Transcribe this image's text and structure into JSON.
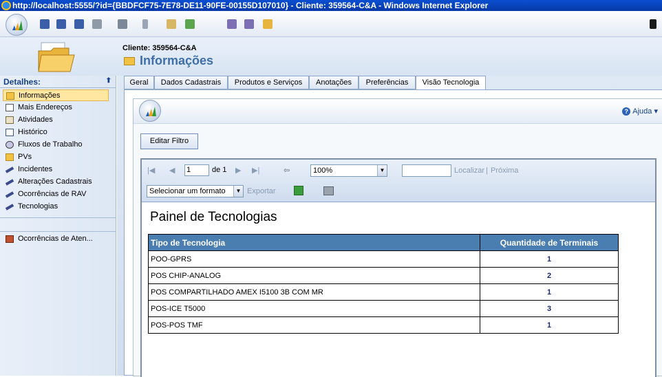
{
  "window": {
    "title": "http://localhost:5555/?id={BBDFCF75-7E78-DE11-90FE-00155D107010} - Cliente: 359564-C&A - Windows Internet Explorer"
  },
  "header": {
    "client": "Cliente: 359564-C&A",
    "title": "Informações"
  },
  "sidebar": {
    "title": "Detalhes:",
    "items": [
      {
        "label": "Informações",
        "icon": "folder-icon"
      },
      {
        "label": "Mais Endereços",
        "icon": "address-icon"
      },
      {
        "label": "Atividades",
        "icon": "activities-icon"
      },
      {
        "label": "Histórico",
        "icon": "history-icon"
      },
      {
        "label": "Fluxos de Trabalho",
        "icon": "workflow-icon"
      },
      {
        "label": "PVs",
        "icon": "folder-icon"
      },
      {
        "label": "Incidentes",
        "icon": "pen-icon"
      },
      {
        "label": "Alterações Cadastrais",
        "icon": "pen-icon"
      },
      {
        "label": "Ocorrências de RAV",
        "icon": "pen-icon"
      },
      {
        "label": "Tecnologias",
        "icon": "pen-icon"
      }
    ],
    "extra_item": {
      "label": "Ocorrências de Aten...",
      "icon": "briefcase-icon"
    }
  },
  "tabs": [
    "Geral",
    "Dados Cadastrais",
    "Produtos e Serviços",
    "Anotações",
    "Preferências",
    "Visão Tecnologia"
  ],
  "active_tab": "Visão Tecnologia",
  "panel": {
    "help_label": "Ajuda",
    "filter_button": "Editar Filtro"
  },
  "report_toolbar": {
    "page_value": "1",
    "page_of": "de 1",
    "zoom": "100%",
    "find_label": "Localizar",
    "separator": "|",
    "next_label": "Próxima",
    "format_select": "Selecionar um formato",
    "export_label": "Exportar"
  },
  "report": {
    "title": "Painel de Tecnologias",
    "columns": [
      "Tipo de Tecnologia",
      "Quantidade de Terminais"
    ],
    "rows": [
      [
        "POO-GPRS",
        "1"
      ],
      [
        "POS CHIP-ANALOG",
        "2"
      ],
      [
        "POS COMPARTILHADO AMEX I5100 3B COM MR",
        "1"
      ],
      [
        "POS-ICE T5000",
        "3"
      ],
      [
        "POS-POS TMF",
        "1"
      ]
    ]
  },
  "colors": {
    "accent": "#3e6fa8",
    "table_header": "#4a7eb0",
    "active_item": "#ffe7a2"
  }
}
